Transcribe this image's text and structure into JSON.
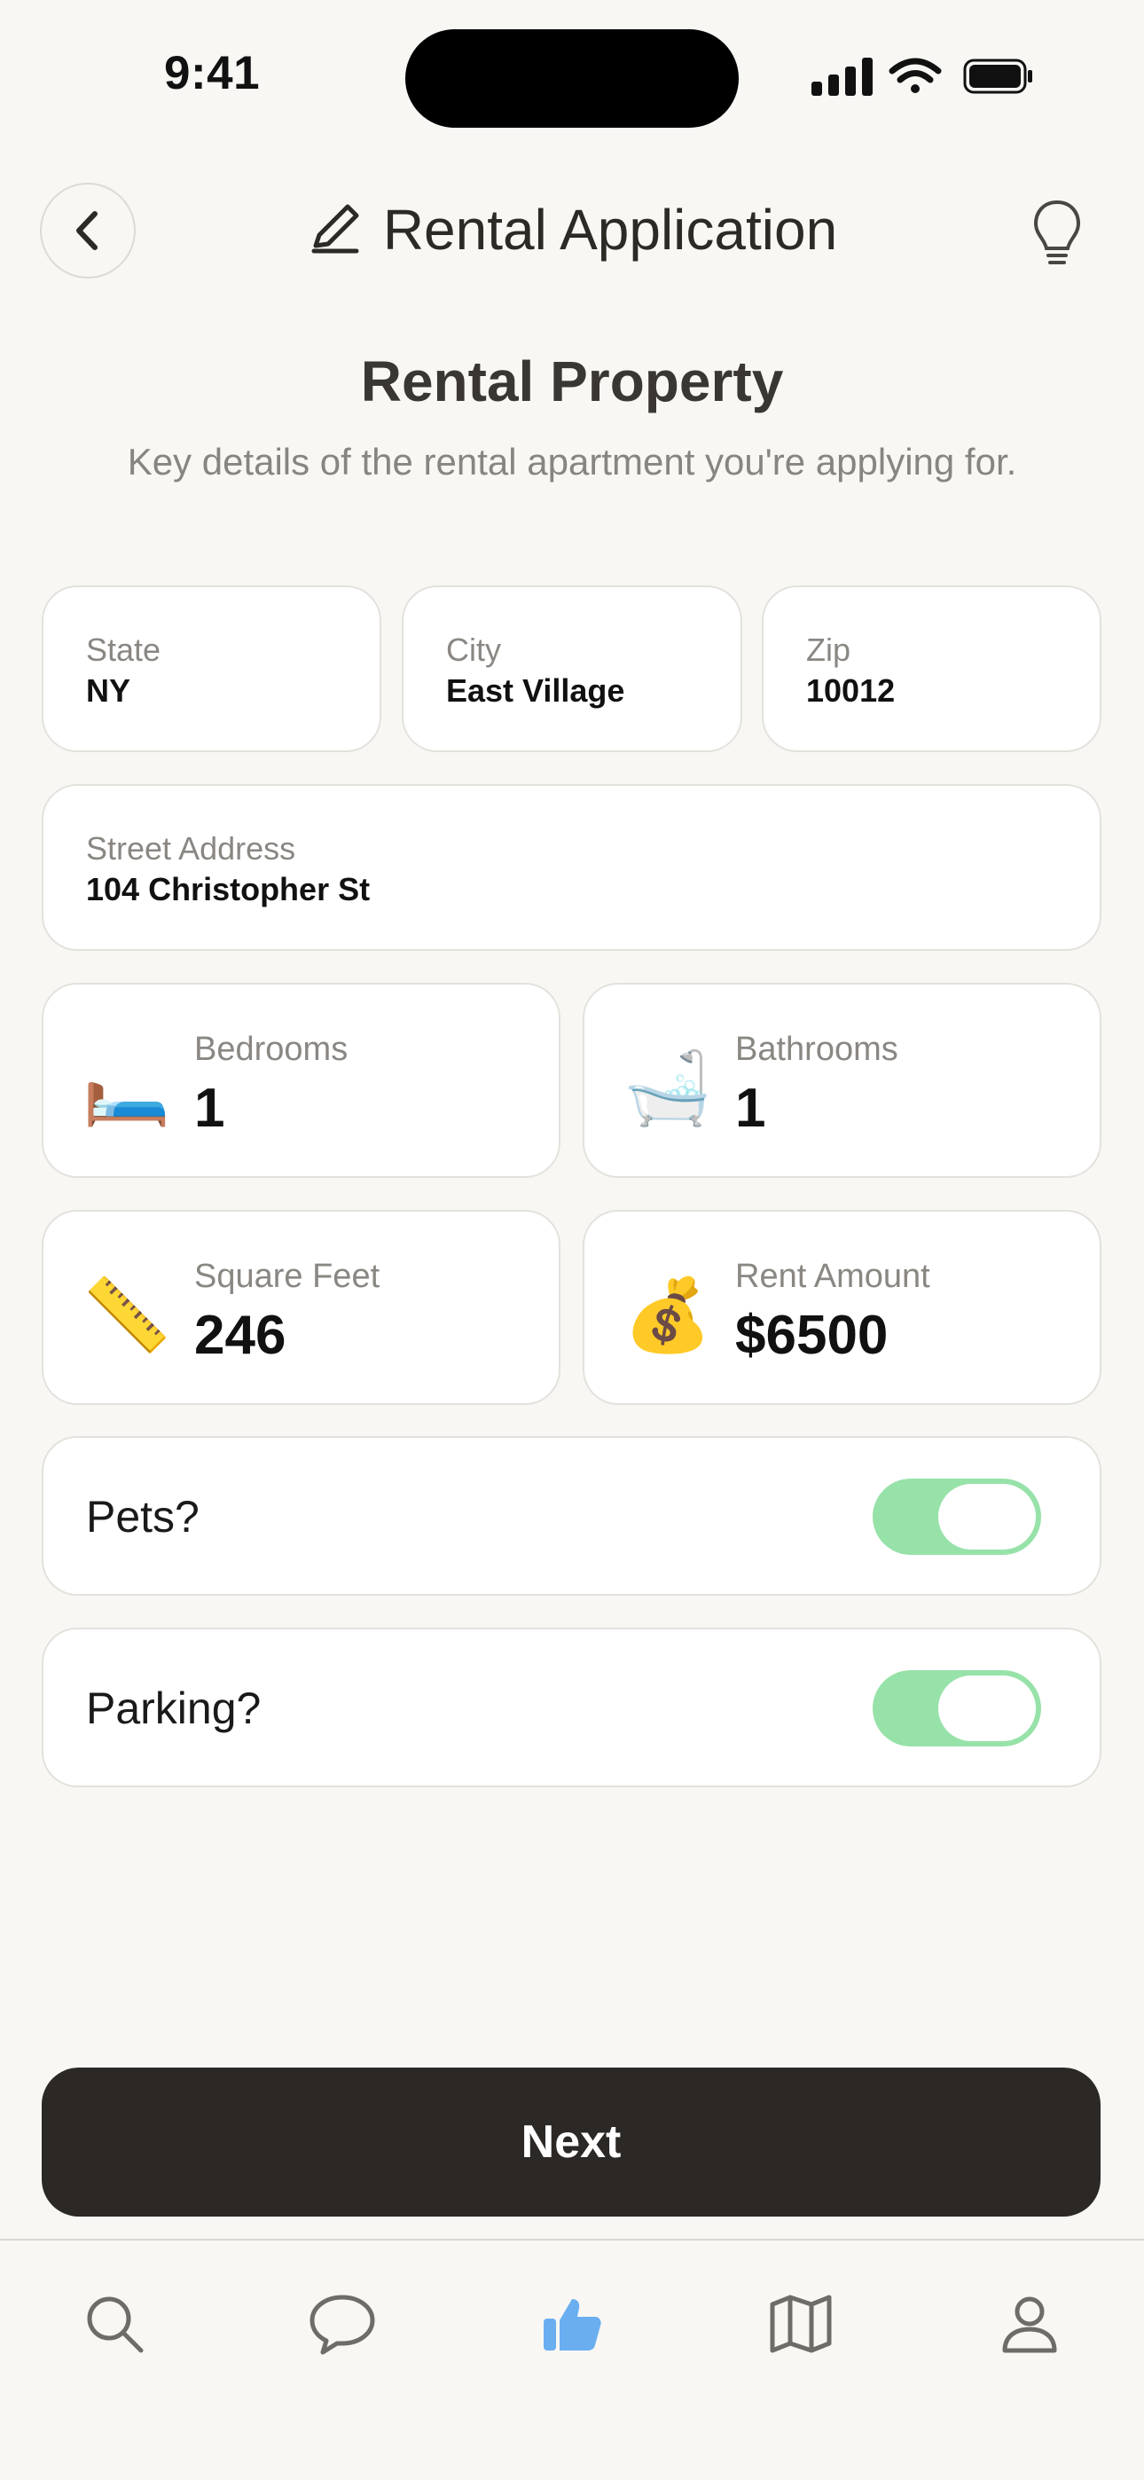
{
  "status_bar": {
    "time": "9:41"
  },
  "header": {
    "title": "Rental Application"
  },
  "section": {
    "title": "Rental Property",
    "subtitle": "Key details of the rental apartment you're applying for."
  },
  "location": {
    "state": {
      "label": "State",
      "value": "NY"
    },
    "city": {
      "label": "City",
      "value": "East Village"
    },
    "zip": {
      "label": "Zip",
      "value": "10012"
    },
    "street": {
      "label": "Street Address",
      "value": "104 Christopher St"
    }
  },
  "stats": {
    "bedrooms": {
      "label": "Bedrooms",
      "value": "1",
      "icon": "bed-icon"
    },
    "bathrooms": {
      "label": "Bathrooms",
      "value": "1",
      "icon": "bathtub-icon"
    },
    "square_feet": {
      "label": "Square Feet",
      "value": "246",
      "icon": "ruler-icon"
    },
    "rent": {
      "label": "Rent Amount",
      "value": "$6500",
      "icon": "money-bag-icon"
    }
  },
  "toggles": {
    "pets": {
      "label": "Pets?",
      "on": true
    },
    "parking": {
      "label": "Parking?",
      "on": true
    }
  },
  "next_label": "Next",
  "colors": {
    "background": "#f8f7f4",
    "toggle_on": "#97e2a9",
    "primary_button": "#2b2825",
    "active_tab": "#6aaef0"
  },
  "tabs": [
    {
      "icon": "search-icon",
      "active": false
    },
    {
      "icon": "chat-bubble-icon",
      "active": false
    },
    {
      "icon": "thumbs-up-icon",
      "active": true
    },
    {
      "icon": "map-icon",
      "active": false
    },
    {
      "icon": "profile-icon",
      "active": false
    }
  ]
}
